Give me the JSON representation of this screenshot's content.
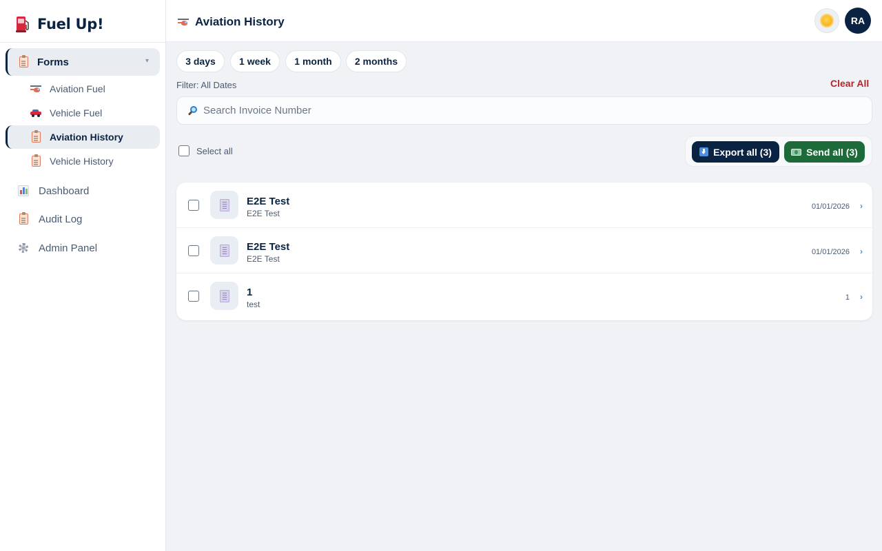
{
  "app": {
    "title": "Fuel Up!"
  },
  "sidebar": {
    "group": {
      "label": "Forms"
    },
    "subitems": [
      {
        "label": "Aviation Fuel"
      },
      {
        "label": "Vehicle Fuel"
      },
      {
        "label": "Aviation History"
      },
      {
        "label": "Vehicle History"
      }
    ],
    "items": [
      {
        "label": "Dashboard"
      },
      {
        "label": "Audit Log"
      },
      {
        "label": "Admin Panel"
      }
    ]
  },
  "header": {
    "title": "Aviation History",
    "avatar_initials": "RA"
  },
  "filters": {
    "chips": [
      "3 days",
      "1 week",
      "1 month",
      "2 months"
    ],
    "status": "Filter: All Dates",
    "clear_label": "Clear All"
  },
  "search": {
    "placeholder": "Search Invoice Number",
    "value": ""
  },
  "bulk": {
    "select_all_label": "Select all",
    "export_label": "Export all (3)",
    "send_label": "Send all (3)"
  },
  "records": [
    {
      "title": "E2E Test",
      "subtitle": "E2E Test",
      "date": "01/01/2026"
    },
    {
      "title": "E2E Test",
      "subtitle": "E2E Test",
      "date": "01/01/2026"
    },
    {
      "title": "1",
      "subtitle": "test",
      "date": "1"
    }
  ],
  "colors": {
    "primary": "#0a2342",
    "send": "#1e6b3a",
    "danger": "#b3262b",
    "background": "#f0f2f5"
  }
}
